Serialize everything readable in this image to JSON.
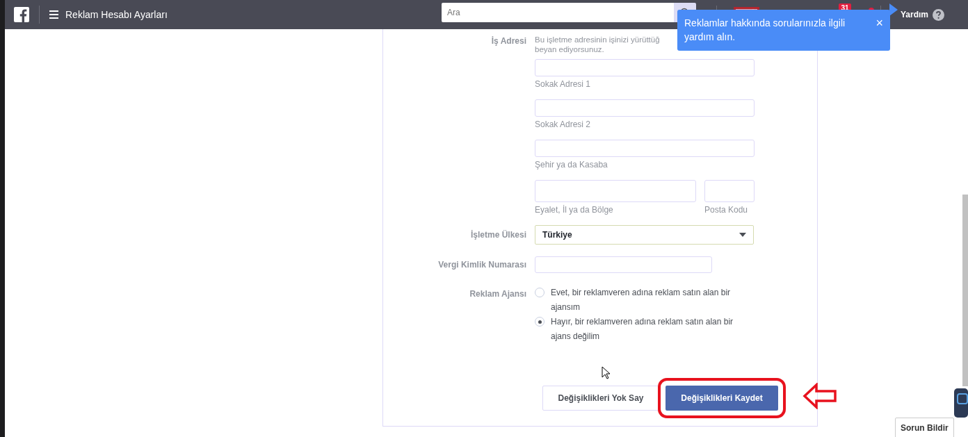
{
  "header": {
    "title": "Reklam Hesabı Ayarları",
    "search": {
      "placeholder": "Ara"
    },
    "notification_count": "31",
    "help_label": "Yardım"
  },
  "tooltip": {
    "text": "Reklamlar hakkında sorularınızla ilgili yardım alın.",
    "close": "×"
  },
  "form": {
    "address": {
      "label": "İş Adresi",
      "description": [
        "Bu işletme adresinin işinizi yürüttüğ",
        "beyan ediyorsunuz."
      ],
      "rows": [
        [
          {
            "caption": "Sokak Adresi 1",
            "kind": "full"
          }
        ],
        [
          {
            "caption": "Sokak Adresi 2",
            "kind": "full"
          }
        ],
        [
          {
            "caption": "Şehir ya da Kasaba",
            "kind": "full"
          }
        ],
        [
          {
            "caption": "Eyalet, İl ya da Bölge",
            "kind": "wide"
          },
          {
            "caption": "Posta Kodu",
            "kind": "narrow"
          }
        ]
      ]
    },
    "country": {
      "label": "İşletme Ülkesi",
      "value": "Türkiye"
    },
    "tax_id": {
      "label": "Vergi Kimlik Numarası"
    },
    "agency": {
      "label": "Reklam Ajansı",
      "options": [
        {
          "text": "Evet, bir reklamveren adına reklam satın alan bir ajansım",
          "selected": false
        },
        {
          "text": "Hayır, bir reklamveren adına reklam satın alan bir ajans değilim",
          "selected": true
        }
      ]
    },
    "buttons": [
      {
        "label": "Değişiklikleri Yok Say",
        "kind": "secondary",
        "highlighted": false
      },
      {
        "label": "Değişiklikleri Kaydet",
        "kind": "primary",
        "highlighted": true
      }
    ]
  },
  "report_button": "Sorun Bildir"
}
